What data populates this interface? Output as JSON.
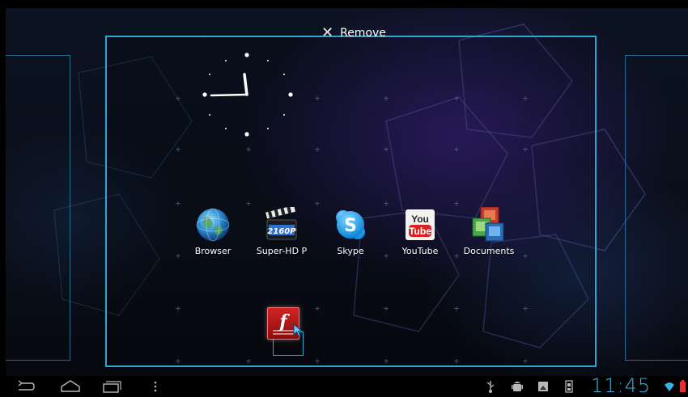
{
  "remove_bar": {
    "label": "Remove"
  },
  "apps": [
    {
      "label": "Browser",
      "icon": "globe-icon"
    },
    {
      "label": "Super-HD P",
      "icon": "clapperboard-icon",
      "badge": "2160P"
    },
    {
      "label": "Skype",
      "icon": "skype-icon",
      "glyph": "S"
    },
    {
      "label": "YouTube",
      "icon": "youtube-icon",
      "top_text": "You",
      "bottom_text": "Tube"
    },
    {
      "label": "Documents",
      "icon": "documents-icon"
    }
  ],
  "dragging_app": {
    "icon": "flash-player-icon",
    "glyph": "f"
  },
  "status_bar": {
    "time": "11:45",
    "icons": [
      "usb-icon",
      "android-debug-icon",
      "screenshot-icon",
      "sd-card-icon",
      "wifi-icon",
      "battery-icon"
    ]
  },
  "colors": {
    "accent": "#32b4e5",
    "frame": "#2fa6cf",
    "flash_red": "#c41818"
  }
}
